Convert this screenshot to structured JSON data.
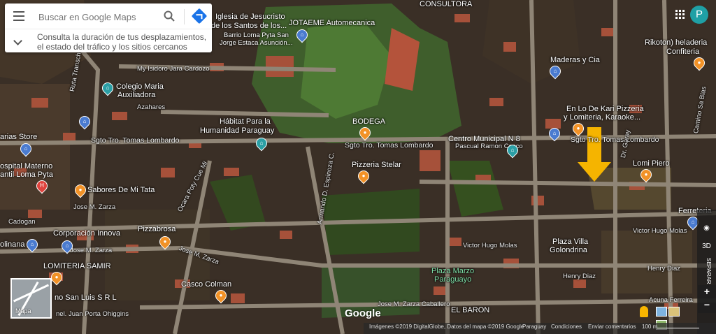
{
  "search": {
    "placeholder": "Buscar en Google Maps",
    "hint": "Consulta la duración de tus desplazamientos, el estado del tráfico y los sitios cercanos"
  },
  "avatar": {
    "letter": "P"
  },
  "map_labels": [
    {
      "text": "Iglesia de Jesucristo",
      "type": "place"
    },
    {
      "text": "de los Santos de los...",
      "type": "place"
    },
    {
      "text": "Barrio Loma Pyta San",
      "type": "place"
    },
    {
      "text": "Jorge Estaca Asunción...",
      "type": "place"
    },
    {
      "text": "JOTAEME Automecanica",
      "type": "place"
    },
    {
      "text": "CONSULTORA",
      "type": "place"
    },
    {
      "text": "Rikoton) heladeria",
      "type": "place"
    },
    {
      "text": "Confiteria",
      "type": "place"
    },
    {
      "text": "Maderas y Cia",
      "type": "place"
    },
    {
      "text": "Colegio Maria",
      "type": "place"
    },
    {
      "text": "Auxiliadora",
      "type": "place"
    },
    {
      "text": "My Isidoro Jara Cardozo",
      "type": "road"
    },
    {
      "text": "Azahares",
      "type": "road"
    },
    {
      "text": "Ruta Transchaco",
      "type": "road"
    },
    {
      "text": "Hábitat Para la",
      "type": "place"
    },
    {
      "text": "Humanidad Paraguay",
      "type": "place"
    },
    {
      "text": "BODEGA",
      "type": "place"
    },
    {
      "text": "En Lo De Kari Pizzeria",
      "type": "place"
    },
    {
      "text": "y Lomiteria, Karaoke...",
      "type": "place"
    },
    {
      "text": "arias Store",
      "type": "place"
    },
    {
      "text": "Sgto Tro. Tomas Lombardo",
      "type": "road"
    },
    {
      "text": "Sgto Tro. Tomas Lombardo",
      "type": "road"
    },
    {
      "text": "Centro Municipal N 8",
      "type": "place"
    },
    {
      "text": "Pascual Ramon Casco",
      "type": "road"
    },
    {
      "text": "Sgto Tro. Tomas Lombardo",
      "type": "road"
    },
    {
      "text": "ospital Materno",
      "type": "place"
    },
    {
      "text": "antil Loma Pyta",
      "type": "place"
    },
    {
      "text": "Pizzeria Stelar",
      "type": "place"
    },
    {
      "text": "Lomi Piero",
      "type": "place"
    },
    {
      "text": "Sabores De Mi Tata",
      "type": "place"
    },
    {
      "text": "Ocara Poty Cue Mi",
      "type": "road"
    },
    {
      "text": "Armando D. Espinoza C.",
      "type": "road"
    },
    {
      "text": "Jose M. Zarza",
      "type": "road"
    },
    {
      "text": "Cadogan",
      "type": "road"
    },
    {
      "text": "Corporación Innova",
      "type": "place"
    },
    {
      "text": "Pizzabrosa",
      "type": "place"
    },
    {
      "text": "Plaza Villa",
      "type": "place"
    },
    {
      "text": "Golondrina",
      "type": "place"
    },
    {
      "text": "Victor Hugo Molas",
      "type": "road"
    },
    {
      "text": "Victor Hugo Molas",
      "type": "road"
    },
    {
      "text": "Ferreteria",
      "type": "place"
    },
    {
      "text": "olinana",
      "type": "place"
    },
    {
      "text": "Jose M. Zarza",
      "type": "road"
    },
    {
      "text": "Jose M. Zarza",
      "type": "road"
    },
    {
      "text": "LOMITERIA SAMIR",
      "type": "place"
    },
    {
      "text": "Plaza Marzo",
      "type": "park"
    },
    {
      "text": "Paraguayo",
      "type": "park"
    },
    {
      "text": "Henry Diaz",
      "type": "road"
    },
    {
      "text": "Henry Diaz",
      "type": "road"
    },
    {
      "text": "Casco Colman",
      "type": "place"
    },
    {
      "text": "no San Luis S R L",
      "type": "place"
    },
    {
      "text": "nel. Juan Porta Ohiggins",
      "type": "road"
    },
    {
      "text": "Jose M. Zarza Caballero",
      "type": "road"
    },
    {
      "text": "EL BARON",
      "type": "place"
    },
    {
      "text": "Acuna Ferreira",
      "type": "road"
    },
    {
      "text": "Camino Sa Blas",
      "type": "road"
    },
    {
      "text": "Dr. Garay",
      "type": "road"
    }
  ],
  "minimap": {
    "label": "Mapa"
  },
  "logo": "Google",
  "footer": {
    "imagery": "Imágenes ©2019 DigitalGlobe, Datos del mapa ©2019 Google",
    "country": "Paraguay",
    "terms": "Condiciones",
    "feedback": "Enviar comentarios",
    "scale": "100 m"
  },
  "controls": {
    "view3d": "3D",
    "separate": "SEPARAR"
  },
  "colors": {
    "map_base": "#2b2a24",
    "vegetation": "#2e4a24",
    "roof": "#a8523a",
    "road": "#8a8070",
    "marker_arrow": "#f5b400",
    "accent": "#1a73e8"
  }
}
